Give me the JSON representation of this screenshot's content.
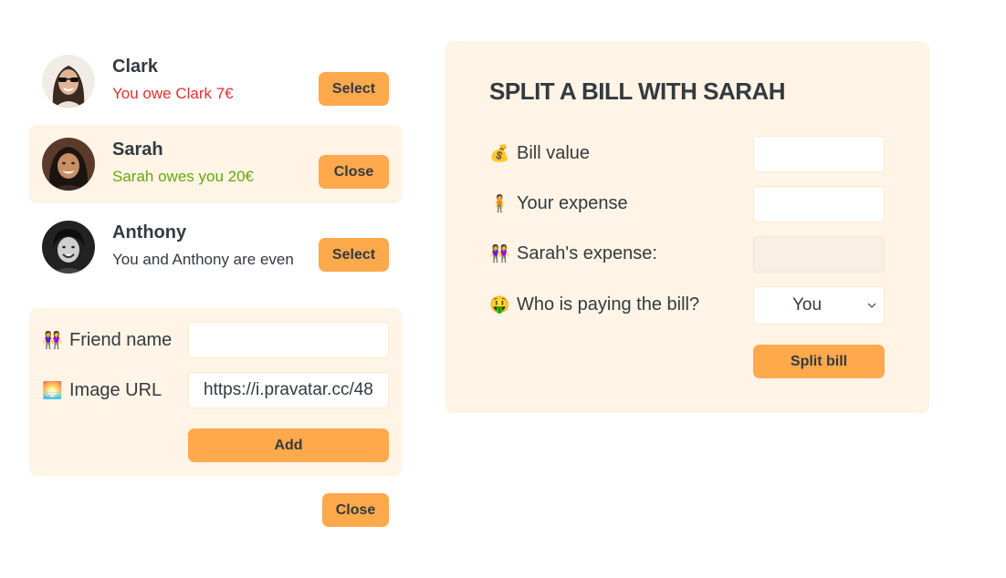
{
  "friends": [
    {
      "name": "Clark",
      "status": "You owe Clark 7€",
      "status_color": "#e03131",
      "button": "Select",
      "selected": false
    },
    {
      "name": "Sarah",
      "status": "Sarah owes you 20€",
      "status_color": "#66a80f",
      "button": "Close",
      "selected": true
    },
    {
      "name": "Anthony",
      "status": "You and Anthony are even",
      "status_color": "#343a40",
      "button": "Select",
      "selected": false
    }
  ],
  "add_form": {
    "name_label": "Friend name",
    "name_value": "",
    "image_label": "Image URL",
    "image_value": "https://i.pravatar.cc/48",
    "add_button": "Add"
  },
  "close_button": "Close",
  "split_form": {
    "title": "SPLIT A BILL WITH SARAH",
    "bill_label": "Bill value",
    "bill_value": "",
    "your_expense_label": "Your expense",
    "your_expense_value": "",
    "friend_expense_label": "Sarah's expense:",
    "friend_expense_value": "",
    "payer_label": "Who is paying the bill?",
    "payer_selected": "You",
    "split_button": "Split bill"
  },
  "colors": {
    "accent": "#ffa94d",
    "panel": "#fff4e6",
    "owe": "#e03131",
    "owed": "#66a80f"
  }
}
